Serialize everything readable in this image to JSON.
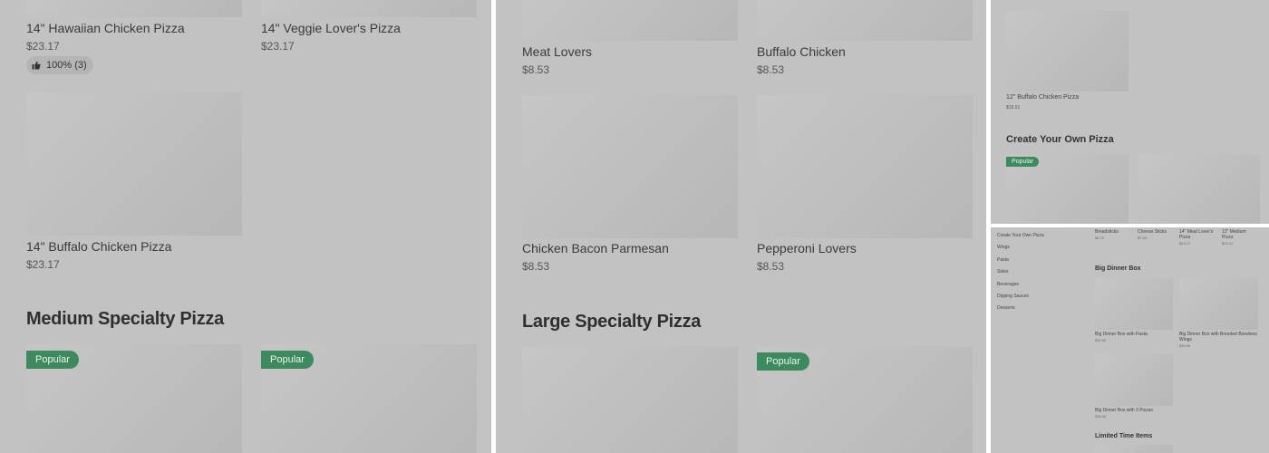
{
  "panel1": {
    "items": [
      {
        "name": "14\" Hawaiian Chicken Pizza",
        "price": "$23.17"
      },
      {
        "name": "14\" Veggie Lover's Pizza",
        "price": "$23.17"
      },
      {
        "name": "14\" Buffalo Chicken Pizza",
        "price": "$23.17"
      }
    ],
    "rating": "100% (3)",
    "heading": "Medium Specialty Pizza",
    "badges": [
      "Popular",
      "Popular"
    ]
  },
  "panel2": {
    "items": [
      {
        "name": "Meat Lovers",
        "price": "$8.53"
      },
      {
        "name": "Buffalo Chicken",
        "price": "$8.53"
      },
      {
        "name": "Chicken Bacon Parmesan",
        "price": "$8.53"
      },
      {
        "name": "Pepperoni Lovers",
        "price": "$8.53"
      }
    ],
    "heading": "Large Specialty Pizza",
    "badge": "Popular"
  },
  "panel3": {
    "item": {
      "name": "12\" Buffalo Chicken Pizza",
      "price": "$19.51"
    },
    "heading": "Create Your Own Pizza",
    "badge": "Popular"
  },
  "panel4": {
    "nav": [
      "Create Your Own Pizza",
      "Wings",
      "Pasta",
      "Sides",
      "Beverages",
      "Dipping Sauces",
      "Desserts"
    ],
    "top_items": [
      {
        "name": "Breadsticks",
        "price": "$6.70"
      },
      {
        "name": "Cheese Sticks",
        "price": "$7.92"
      },
      {
        "name": "14\" Meat Lover's Pizza",
        "price": "$23.17"
      },
      {
        "name": "12\" Medium Pizza",
        "price": "$13.41"
      }
    ],
    "section1": "Big Dinner Box",
    "box_items": [
      {
        "name": "Big Dinner Box with Pasta",
        "price": "$30.90"
      },
      {
        "name": "Big Dinner Box with Breaded Boneless Wings",
        "price": "$30.90"
      },
      {
        "name": "Big Dinner Box with 3 Pizzas",
        "price": "$36.00"
      }
    ],
    "section2": "Limited Time Items"
  },
  "colors": {
    "badge": "#3e8a5f",
    "panel_bg": "#c2c2c2"
  }
}
